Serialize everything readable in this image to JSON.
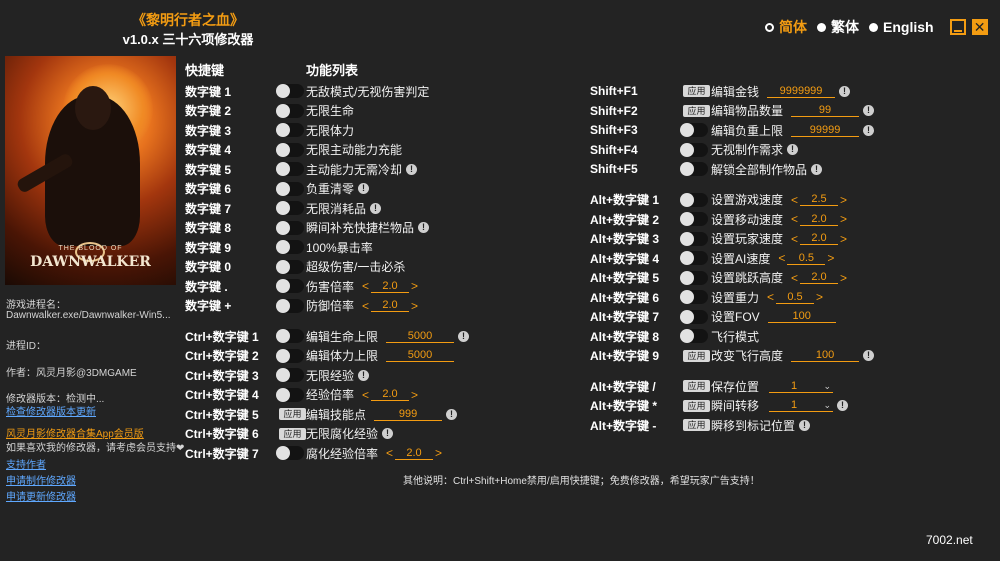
{
  "header": {
    "title": "《黎明行者之血》",
    "subtitle": "v1.0.x 三十六项修改器"
  },
  "languages": [
    {
      "label": "简体",
      "active": true
    },
    {
      "label": "繁体",
      "active": false
    },
    {
      "label": "English",
      "active": false
    }
  ],
  "cover": {
    "logo_small": "THE BLOOD OF",
    "logo_big": "DAWNWALKER"
  },
  "sidebar": {
    "process_label": "游戏进程名：",
    "process_value": "Dawnwalker.exe/Dawnwalker-Win5...",
    "pid_label": "进程ID：",
    "author": "作者：风灵月影@3DMGAME",
    "version": "修改器版本：检测中...",
    "check_update": "检查修改器版本更新",
    "app_link": "风灵月影修改器合集App会员版",
    "support_note": "如果喜欢我的修改器，请考虑会员支持❤",
    "link_support": "支持作者",
    "link_request": "申请制作修改器",
    "link_update": "申请更新修改器"
  },
  "columns": {
    "hotkey": "快捷键",
    "function": "功能列表"
  },
  "left_rows": [
    {
      "key": "数字键 1",
      "ctrl": "toggle",
      "label": "无敌模式/无视伤害判定"
    },
    {
      "key": "数字键 2",
      "ctrl": "toggle",
      "label": "无限生命"
    },
    {
      "key": "数字键 3",
      "ctrl": "toggle",
      "label": "无限体力"
    },
    {
      "key": "数字键 4",
      "ctrl": "toggle",
      "label": "无限主动能力充能"
    },
    {
      "key": "数字键 5",
      "ctrl": "toggle",
      "label": "主动能力无需冷却",
      "info": true
    },
    {
      "key": "数字键 6",
      "ctrl": "toggle",
      "label": "负重清零",
      "info": true
    },
    {
      "key": "数字键 7",
      "ctrl": "toggle",
      "label": "无限消耗品",
      "info": true
    },
    {
      "key": "数字键 8",
      "ctrl": "toggle",
      "label": "瞬间补充快捷栏物品",
      "info": true
    },
    {
      "key": "数字键 9",
      "ctrl": "toggle",
      "label": "100%暴击率"
    },
    {
      "key": "数字键 0",
      "ctrl": "toggle",
      "label": "超级伤害/一击必杀"
    },
    {
      "key": "数字键 .",
      "ctrl": "toggle",
      "label": "伤害倍率",
      "stepper": "2.0"
    },
    {
      "key": "数字键 +",
      "ctrl": "toggle",
      "label": "防御倍率",
      "stepper": "2.0"
    },
    {
      "key": "Ctrl+数字键 1",
      "ctrl": "toggle",
      "label": "编辑生命上限",
      "field": "5000",
      "info": true,
      "gap": true
    },
    {
      "key": "Ctrl+数字键 2",
      "ctrl": "toggle",
      "label": "编辑体力上限",
      "field": "5000"
    },
    {
      "key": "Ctrl+数字键 3",
      "ctrl": "toggle",
      "label": "无限经验",
      "info": true
    },
    {
      "key": "Ctrl+数字键 4",
      "ctrl": "toggle",
      "label": "经验倍率",
      "stepper": "2.0"
    },
    {
      "key": "Ctrl+数字键 5",
      "ctrl": "apply",
      "label": "编辑技能点",
      "field": "999",
      "info": true
    },
    {
      "key": "Ctrl+数字键 6",
      "ctrl": "apply",
      "label": "无限腐化经验",
      "info": true
    },
    {
      "key": "Ctrl+数字键 7",
      "ctrl": "toggle",
      "label": "腐化经验倍率",
      "stepper": "2.0"
    }
  ],
  "right_rows": [
    {
      "key": "Shift+F1",
      "ctrl": "apply",
      "label": "编辑金钱",
      "field": "9999999",
      "info": true
    },
    {
      "key": "Shift+F2",
      "ctrl": "apply",
      "label": "编辑物品数量",
      "field": "99",
      "info": true
    },
    {
      "key": "Shift+F3",
      "ctrl": "toggle",
      "label": "编辑负重上限",
      "field": "99999",
      "info": true
    },
    {
      "key": "Shift+F4",
      "ctrl": "toggle",
      "label": "无视制作需求",
      "info": true
    },
    {
      "key": "Shift+F5",
      "ctrl": "toggle",
      "label": "解锁全部制作物品",
      "info": true
    },
    {
      "key": "Alt+数字键 1",
      "ctrl": "toggle",
      "label": "设置游戏速度",
      "stepper": "2.5",
      "gap": true
    },
    {
      "key": "Alt+数字键 2",
      "ctrl": "toggle",
      "label": "设置移动速度",
      "stepper": "2.0"
    },
    {
      "key": "Alt+数字键 3",
      "ctrl": "toggle",
      "label": "设置玩家速度",
      "stepper": "2.0"
    },
    {
      "key": "Alt+数字键 4",
      "ctrl": "toggle",
      "label": "设置AI速度",
      "stepper": "0.5"
    },
    {
      "key": "Alt+数字键 5",
      "ctrl": "toggle",
      "label": "设置跳跃高度",
      "stepper": "2.0"
    },
    {
      "key": "Alt+数字键 6",
      "ctrl": "toggle",
      "label": "设置重力",
      "stepper": "0.5"
    },
    {
      "key": "Alt+数字键 7",
      "ctrl": "toggle",
      "label": "设置FOV",
      "field": "100"
    },
    {
      "key": "Alt+数字键 8",
      "ctrl": "toggle",
      "label": "飞行模式"
    },
    {
      "key": "Alt+数字键 9",
      "ctrl": "apply",
      "label": "改变飞行高度",
      "field": "100",
      "info": true
    },
    {
      "key": "Alt+数字键 /",
      "ctrl": "apply",
      "label": "保存位置",
      "dropdown": "1",
      "gap": true
    },
    {
      "key": "Alt+数字键 *",
      "ctrl": "apply",
      "label": "瞬间转移",
      "dropdown": "1",
      "info": true
    },
    {
      "key": "Alt+数字键 -",
      "ctrl": "apply",
      "label": "瞬移到标记位置",
      "info": true
    }
  ],
  "apply_label": "应用",
  "footer": "其他说明：Ctrl+Shift+Home禁用/启用快捷键；免费修改器，希望玩家广告支持！",
  "watermark": "7002.net"
}
